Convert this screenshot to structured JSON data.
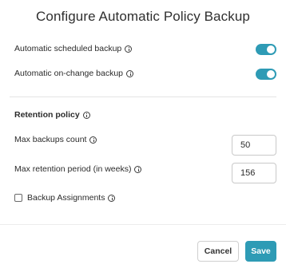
{
  "dialog": {
    "title": "Configure Automatic Policy Backup"
  },
  "backup": {
    "scheduled_label": "Automatic scheduled backup",
    "scheduled_enabled": true,
    "onchange_label": "Automatic on-change backup",
    "onchange_enabled": true
  },
  "retention": {
    "section_title": "Retention policy",
    "max_count_label": "Max backups count",
    "max_count_value": "50",
    "max_period_label": "Max retention period (in weeks)",
    "max_period_value": "156",
    "assignments_label": "Backup Assignments",
    "assignments_checked": false
  },
  "footer": {
    "cancel_label": "Cancel",
    "save_label": "Save"
  },
  "colors": {
    "accent": "#2e9bb5"
  },
  "icons": {
    "info": "info-icon"
  }
}
